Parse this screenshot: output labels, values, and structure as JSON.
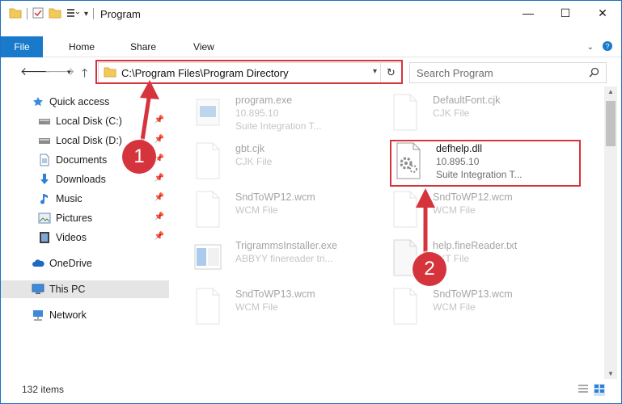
{
  "window": {
    "title": "Program",
    "controls": {
      "minimize": "—",
      "maximize": "☐",
      "close": "✕"
    }
  },
  "ribbon": {
    "tabs": [
      "File",
      "Home",
      "Share",
      "View"
    ]
  },
  "address": {
    "path": "C:\\Program Files\\Program Directory"
  },
  "search": {
    "placeholder": "Search Program"
  },
  "sidebar": {
    "items": [
      {
        "label": "Quick access",
        "icon": "star-icon"
      },
      {
        "label": "Local Disk (C:)",
        "icon": "drive-icon",
        "pinned": true
      },
      {
        "label": "Local Disk (D:)",
        "icon": "drive-icon",
        "pinned": true
      },
      {
        "label": "Documents",
        "icon": "documents-icon",
        "pinned": true
      },
      {
        "label": "Downloads",
        "icon": "download-icon",
        "pinned": true
      },
      {
        "label": "Music",
        "icon": "music-icon",
        "pinned": true
      },
      {
        "label": "Pictures",
        "icon": "pictures-icon",
        "pinned": true
      },
      {
        "label": "Videos",
        "icon": "videos-icon",
        "pinned": true
      },
      {
        "label": "OneDrive",
        "icon": "cloud-icon"
      },
      {
        "label": "This PC",
        "icon": "computer-icon"
      },
      {
        "label": "Network",
        "icon": "network-icon"
      }
    ]
  },
  "files": [
    {
      "name": "program.exe",
      "line2": "10.895.10",
      "line3": "Suite Integration T...",
      "faded": true
    },
    {
      "name": "DefaultFont.cjk",
      "line2": "CJK File",
      "line3": "",
      "faded": true
    },
    {
      "name": "gbt.cjk",
      "line2": "CJK File",
      "line3": "",
      "faded": true
    },
    {
      "name": "defhelp.dll",
      "line2": "10.895.10",
      "line3": "Suite Integration T...",
      "faded": false
    },
    {
      "name": "SndToWP12.wcm",
      "line2": "WCM File",
      "line3": "",
      "faded": true
    },
    {
      "name": "SndToWP12.wcm",
      "line2": "WCM File",
      "line3": "",
      "faded": true
    },
    {
      "name": "TrigrammsInstaller.exe",
      "line2": "ABBYY finereader tri...",
      "line3": "",
      "faded": true
    },
    {
      "name": "help.fineReader.txt",
      "line2": "TXT File",
      "line3": "",
      "faded": true
    },
    {
      "name": "SndToWP13.wcm",
      "line2": "WCM File",
      "line3": "",
      "faded": true
    },
    {
      "name": "SndToWP13.wcm",
      "line2": "WCM File",
      "line3": "",
      "faded": true
    }
  ],
  "status": {
    "item_count": "132 items"
  },
  "annotations": {
    "step1": "1",
    "step2": "2",
    "color": "#d6343d"
  },
  "colors": {
    "accent": "#1979ca",
    "selection": "#cce4f7",
    "highlight": "#d6343d"
  }
}
